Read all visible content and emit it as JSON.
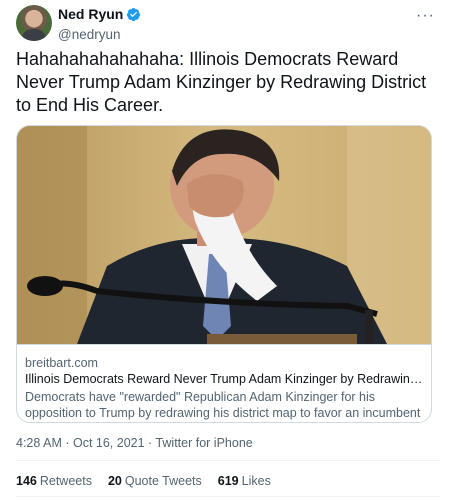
{
  "user": {
    "display_name": "Ned Ryun",
    "handle": "@nedryun",
    "verified_icon": "verified-badge-icon"
  },
  "tweet_text": "Hahahahahahahaha: Illinois Democrats Reward Never Trump Adam Kinzinger by Redrawing District to End His Career.",
  "card": {
    "domain": "breitbart.com",
    "title": "Illinois Democrats Reward Never Trump Adam Kinzinger by Redrawing District t…",
    "description": "Democrats have \"rewarded\" Republican Adam Kinzinger for his opposition to Trump by redrawing his district map to favor an incumbent Democrat."
  },
  "meta": {
    "time": "4:28 AM",
    "separator": " · ",
    "date": "Oct 16, 2021",
    "source": "Twitter for iPhone"
  },
  "stats": {
    "retweets_count": "146",
    "retweets_label": "Retweets",
    "quotes_count": "20",
    "quotes_label": "Quote Tweets",
    "likes_count": "619",
    "likes_label": "Likes"
  },
  "colors": {
    "accent": "#1d9bf0",
    "text_primary": "#0f1419",
    "text_secondary": "#536471",
    "border": "#cfd9de"
  }
}
